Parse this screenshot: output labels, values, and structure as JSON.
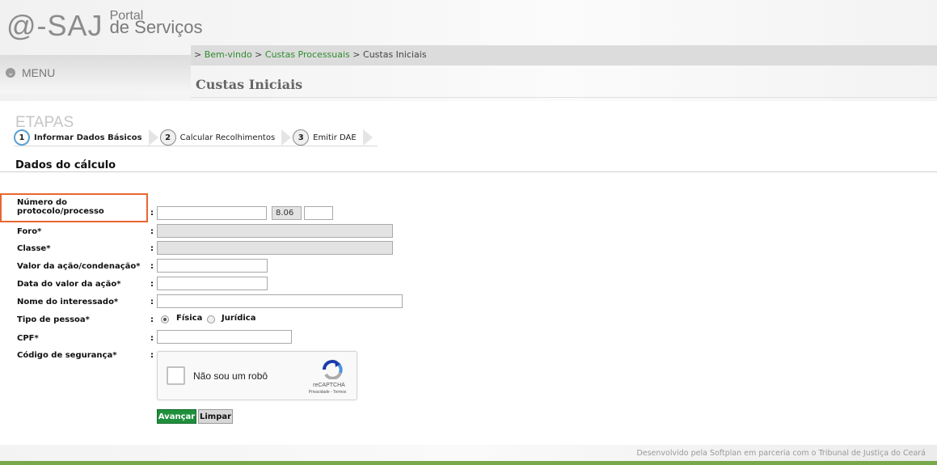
{
  "header": {
    "logo_main": "@-SAJ",
    "logo_portal_line1": "Portal",
    "logo_portal_line2": "de Serviços",
    "menu_label": "MENU"
  },
  "breadcrumb": {
    "sep1": "> ",
    "item1": "Bem-vindo",
    "sep2": " > ",
    "item2": "Custas Processuais",
    "sep3": " > ",
    "current": "Custas Iniciais"
  },
  "page": {
    "title": "Custas Iniciais"
  },
  "steps": {
    "heading": "ETAPAS",
    "items": [
      {
        "num": "1",
        "label": "Informar Dados Básicos"
      },
      {
        "num": "2",
        "label": "Calcular Recolhimentos"
      },
      {
        "num": "3",
        "label": "Emitir DAE"
      }
    ]
  },
  "section": {
    "title": "Dados do cálculo"
  },
  "form": {
    "colon": ":",
    "protocolo_label_line1": "Número do",
    "protocolo_label_line2": "protocolo/processo",
    "protocolo_mid_value": "8.06",
    "foro_label": "Foro*",
    "classe_label": "Classe*",
    "valor_label": "Valor da ação/condenação*",
    "data_label": "Data do valor da ação*",
    "nome_label": "Nome do interessado*",
    "tipo_label": "Tipo de pessoa*",
    "tipo_options": [
      "Física",
      "Jurídica"
    ],
    "tipo_selected": "Física",
    "cpf_label": "CPF*",
    "codigo_label": "Código de segurança*",
    "captcha_text": "Não sou um robô",
    "captcha_brand": "reCAPTCHA",
    "captcha_links": "Privacidade - Termos",
    "btn_advance": "Avançar",
    "btn_clear": "Limpar"
  },
  "footer": {
    "text": "Desenvolvido pela Softplan em parceria com o Tribunal de Justiça do Ceará"
  },
  "colors": {
    "accent_green": "#1f8f3c",
    "link_green": "#2e8b2e",
    "highlight_orange": "#e8672f",
    "footer_bar": "#79a84a"
  }
}
